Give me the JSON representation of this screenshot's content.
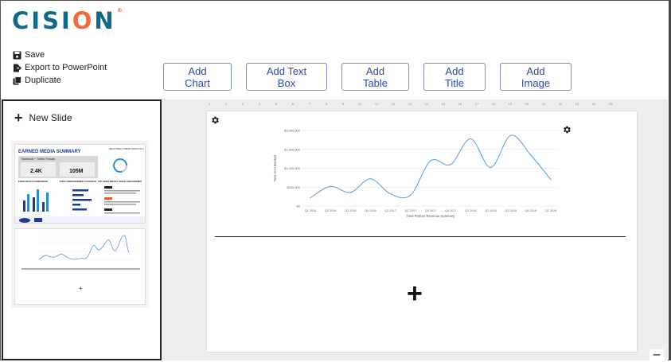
{
  "brand": {
    "logo_text_1": "CISI",
    "logo_text_o": "O",
    "logo_text_2": "N",
    "trademark": "®",
    "primary_color": "#0f6a8a",
    "accent_color": "#f26b3a"
  },
  "actions": [
    {
      "label": "Save",
      "icon": "floppy-disk-icon"
    },
    {
      "label": "Export to PowerPoint",
      "icon": "export-file-icon"
    },
    {
      "label": "Duplicate",
      "icon": "duplicate-icon"
    }
  ],
  "toolbar": {
    "add_chart": "Add Chart",
    "add_text_box": "Add Text Box",
    "add_table": "Add Table",
    "add_title": "Add Title",
    "add_image": "Add Image",
    "button_color": "#2b4aa0"
  },
  "sidebar": {
    "new_slide": "New Slide",
    "thumb1": {
      "title": "EARNED MEDIA SUMMARY",
      "corner": "NEGOTIABLE STREAM CROWD 2021",
      "section": "Traditional + Twitter Results",
      "metric1": "2.4K",
      "metric2": "105M",
      "panel1": "EVENT REACH COMPARISON",
      "panel2": "TOPIC ANNOUNCEMENT COVERAGE",
      "panel3": "TOP HEADLINES BY SOCIAL ENGAGEMENT"
    },
    "thumb2_plus": "+"
  },
  "ruler": {
    "top_numbers": [
      "1",
      "2",
      "3",
      "4",
      "5",
      "6",
      "7",
      "8",
      "9",
      "10",
      "11",
      "12",
      "13",
      "14",
      "15",
      "16",
      "17",
      "18",
      "19",
      "20",
      "21",
      "22",
      "23",
      "24",
      "25"
    ]
  },
  "slide": {
    "add_plus": "+"
  },
  "chart_data": {
    "type": "line",
    "title": "",
    "xlabel": "Total Partner Revenue Summary",
    "ylabel": "Total ACV Booked",
    "categories": [
      "Q1 2016",
      "Q2 2016",
      "Q3 2016",
      "Q4 2016",
      "Q1 2017",
      "Q2 2017",
      "Q3 2017",
      "Q4 2017",
      "Q1 2018",
      "Q2 2018",
      "Q3 2018",
      "Q4 2018",
      "Q1 2019"
    ],
    "values": [
      220000,
      520000,
      360000,
      720000,
      320000,
      290000,
      1200000,
      1100000,
      1780000,
      1020000,
      1870000,
      1350000,
      700000
    ],
    "series": [
      {
        "name": "",
        "color": "#5b9bd5"
      }
    ],
    "ytick_labels": [
      "$0",
      "$500,000",
      "$1,000,000",
      "$1,500,000",
      "$2,000,000"
    ],
    "ylim": [
      0,
      2000000
    ],
    "grid": true
  },
  "minimize_label": "–"
}
